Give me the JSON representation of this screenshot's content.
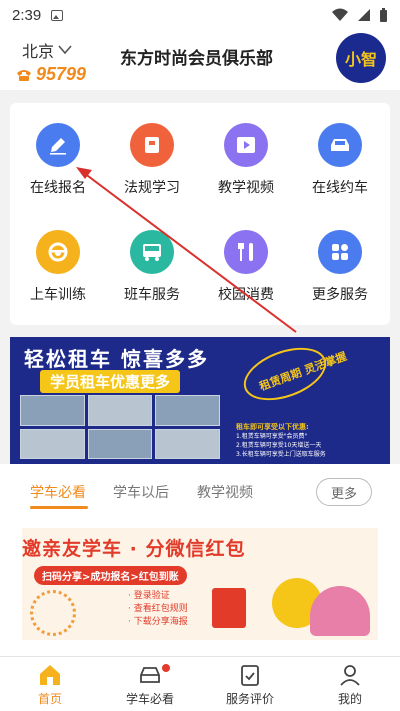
{
  "status_bar": {
    "time": "2:39"
  },
  "header": {
    "city": "北京",
    "phone": "95799",
    "title": "东方时尚会员俱乐部",
    "avatar_text": "小智"
  },
  "menu": [
    {
      "label": "在线报名",
      "icon": "edit-icon",
      "color": "#4a7cf0"
    },
    {
      "label": "法规学习",
      "icon": "book-icon",
      "color": "#f0623c"
    },
    {
      "label": "教学视频",
      "icon": "video-icon",
      "color": "#8a72f0"
    },
    {
      "label": "在线约车",
      "icon": "car-icon",
      "color": "#4a7cf0"
    },
    {
      "label": "上车训练",
      "icon": "steering-wheel-icon",
      "color": "#f5b21c"
    },
    {
      "label": "班车服务",
      "icon": "bus-icon",
      "color": "#2bb8a0"
    },
    {
      "label": "校园消费",
      "icon": "cutlery-icon",
      "color": "#8a72f0"
    },
    {
      "label": "更多服务",
      "icon": "grid-icon",
      "color": "#4a7cf0"
    }
  ],
  "banner1": {
    "title": "轻松租车 惊喜多多",
    "subtitle": "学员租车优惠更多",
    "badge": "租赁周期 灵活掌握",
    "info_heading": "租车即可享受以下优惠:",
    "info_lines": [
      "1.租赁车辆可享受\"会员费\"",
      "2.租赁车辆可享受10天增送一天",
      "3.长租车辆可享受上门送取车服务"
    ]
  },
  "tabs": {
    "items": [
      "学车必看",
      "学车以后",
      "教学视频"
    ],
    "active": 0,
    "more_label": "更多"
  },
  "banner2": {
    "title": "邀亲友学车 · 分微信红包",
    "pill": "扫码分享>成功报名>红包到账",
    "steps": [
      "· 登录验证",
      "· 查看红包规则",
      "· 下载分享海报"
    ]
  },
  "bottom_nav": [
    {
      "label": "首页",
      "icon": "home-icon",
      "active": true
    },
    {
      "label": "学车必看",
      "icon": "car-icon",
      "active": false
    },
    {
      "label": "服务评价",
      "icon": "clipboard-icon",
      "active": false
    },
    {
      "label": "我的",
      "icon": "user-icon",
      "active": false
    }
  ],
  "colors": {
    "accent": "#f08a1c",
    "avatar_bg": "#1a2a8e",
    "avatar_text": "#f5c518",
    "banner_blue": "#1e2a8a",
    "arrow": "#d9302b"
  }
}
